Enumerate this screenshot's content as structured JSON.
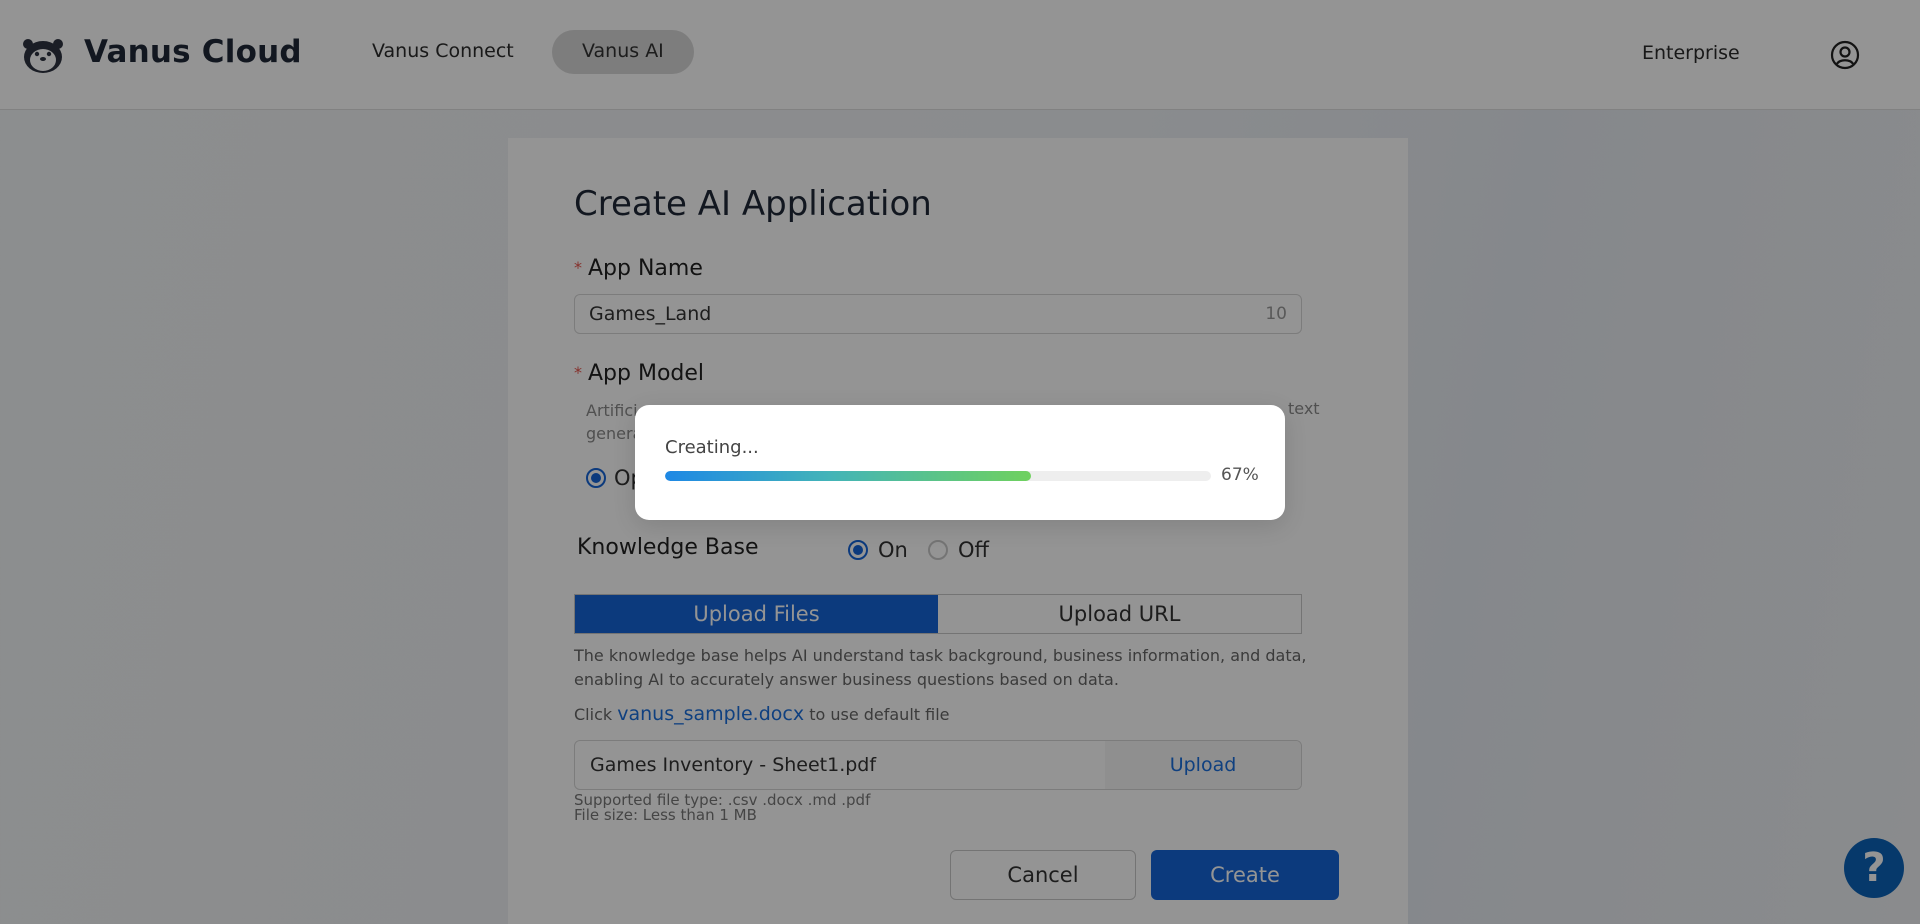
{
  "header": {
    "brand": "Vanus Cloud",
    "nav": [
      {
        "label": "Vanus Connect"
      },
      {
        "label": "Vanus AI"
      }
    ],
    "enterprise": "Enterprise",
    "icons": {
      "logo": "otter-logo-icon",
      "user": "user-circle-icon"
    }
  },
  "form": {
    "title": "Create AI Application",
    "app_name": {
      "label": "App Name",
      "value": "Games_Land",
      "count": "10"
    },
    "app_model": {
      "label": "App Model",
      "desc_fragment_left_1": "Artifici",
      "desc_fragment_left_2": "genera",
      "desc_fragment_right": "text",
      "option_fragment": "Op"
    },
    "knowledge_base": {
      "label": "Knowledge Base",
      "on": "On",
      "off": "Off",
      "selected": "On"
    },
    "tabs": [
      {
        "label": "Upload Files",
        "active": true
      },
      {
        "label": "Upload URL",
        "active": false
      }
    ],
    "kb_desc": "The knowledge base helps AI understand task background, business information, and data, enabling AI to accurately answer business questions based on data.",
    "sample": {
      "prefix": "Click",
      "link": "vanus_sample.docx",
      "suffix": "to use default file"
    },
    "file": {
      "name": "Games Inventory - Sheet1.pdf",
      "upload_label": "Upload"
    },
    "hint_types": "Supported file type: .csv .docx .md .pdf",
    "hint_size": "File size: Less than 1 MB",
    "cancel": "Cancel",
    "create": "Create"
  },
  "help": "?",
  "modal": {
    "status": "Creating...",
    "progress": 0.67,
    "progress_label": "67%"
  },
  "colors": {
    "primary": "#1565d8",
    "link": "#1a6fdc",
    "help": "#0b63b8",
    "required": "#e5534b"
  }
}
